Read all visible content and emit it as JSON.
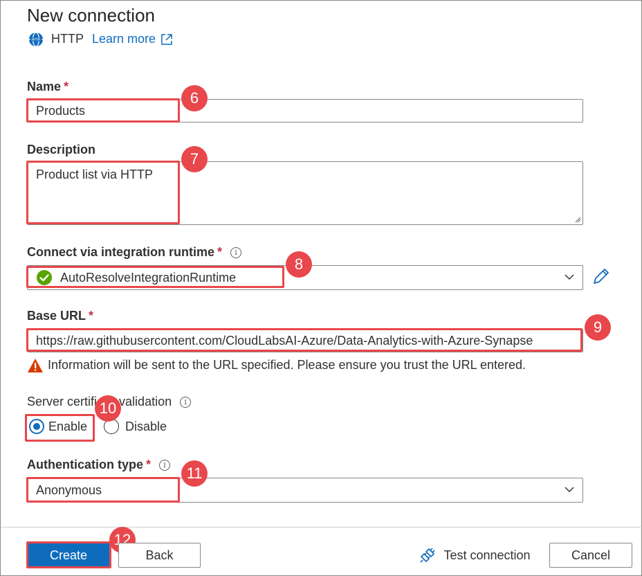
{
  "header": {
    "title": "New connection",
    "connector_type": "HTTP",
    "learn_more_label": "Learn more"
  },
  "name": {
    "label": "Name",
    "required_marker": "*",
    "value": "Products",
    "badge": "6"
  },
  "description": {
    "label": "Description",
    "value": "Product list via HTTP",
    "badge": "7"
  },
  "integration_runtime": {
    "label": "Connect via integration runtime",
    "required_marker": "*",
    "info_glyph": "i",
    "value": "AutoResolveIntegrationRuntime",
    "badge": "8"
  },
  "base_url": {
    "label": "Base URL",
    "required_marker": "*",
    "value": "https://raw.githubusercontent.com/CloudLabsAI-Azure/Data-Analytics-with-Azure-Synapse",
    "badge": "9",
    "warning": "Information will be sent to the URL specified. Please ensure you trust the URL entered."
  },
  "server_cert": {
    "label_before": "Server certifi",
    "label_after": "te validation",
    "info_glyph": "i",
    "options": [
      "Enable",
      "Disable"
    ],
    "selected": "Enable",
    "badge": "10"
  },
  "auth_type": {
    "label": "Authentication type",
    "required_marker": "*",
    "info_glyph": "i",
    "value": "Anonymous",
    "badge": "11"
  },
  "footer": {
    "create_label": "Create",
    "back_label": "Back",
    "test_connection_label": "Test connection",
    "cancel_label": "Cancel",
    "badge": "12"
  },
  "colors": {
    "accent": "#0f6cbd",
    "highlight": "#e8474c",
    "required": "#c4314b",
    "success": "#57a300",
    "warning": "#d83b01"
  },
  "icons": [
    "globe-icon",
    "external-link-icon",
    "success-check-icon",
    "chevron-down-icon",
    "edit-pencil-icon",
    "warning-icon",
    "info-icon",
    "plug-icon"
  ]
}
